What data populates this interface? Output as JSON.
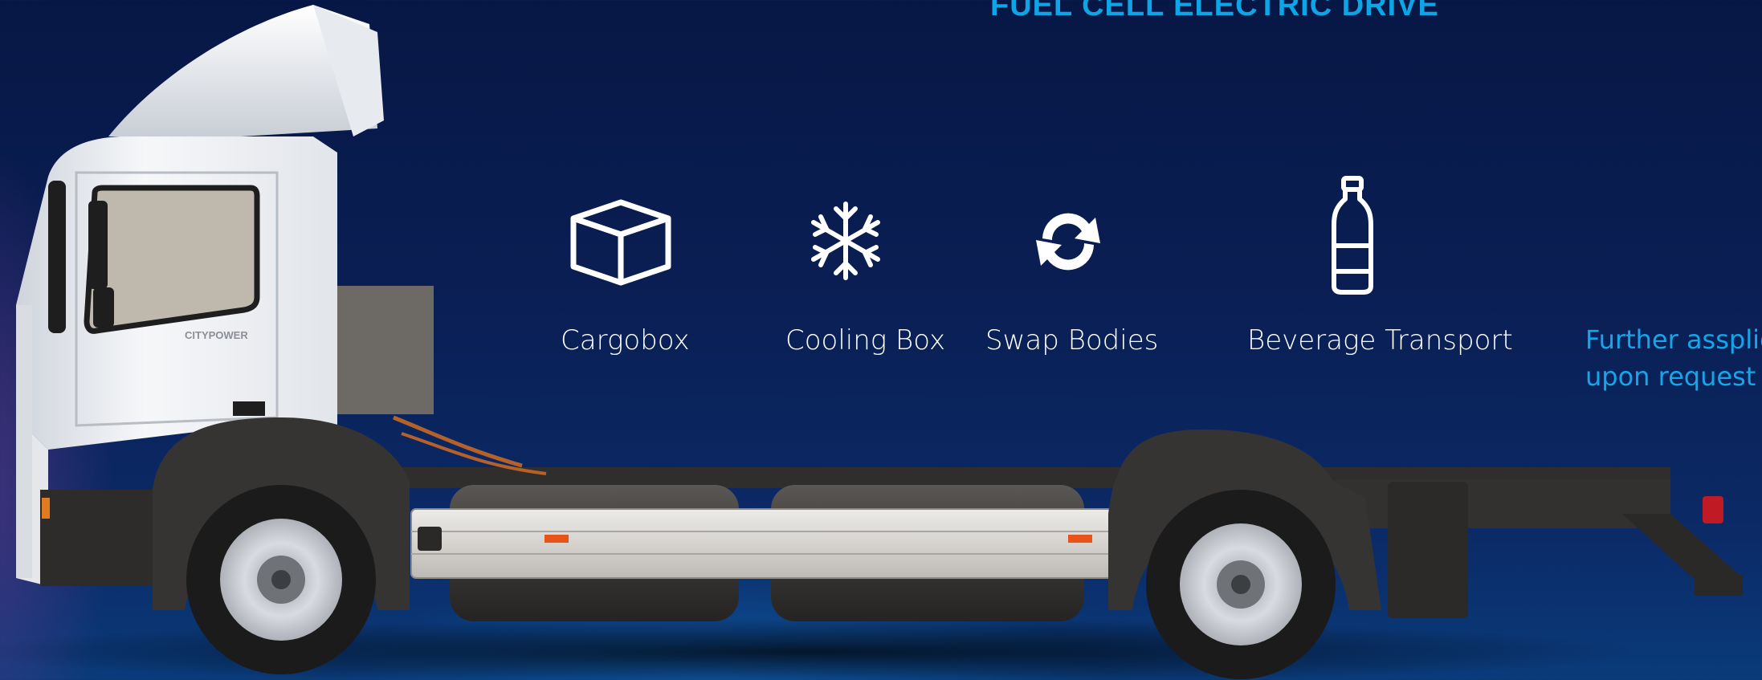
{
  "headline": "FUEL CELL ELECTRIC DRIVE",
  "applications": [
    {
      "label": "Cargobox",
      "icon": "box-icon"
    },
    {
      "label": "Cooling Box",
      "icon": "snowflake-icon"
    },
    {
      "label": "Swap Bodies",
      "icon": "swap-arrows-icon"
    },
    {
      "label": "Beverage Transport",
      "icon": "bottle-icon"
    }
  ],
  "further": {
    "line1": "Further assplic",
    "line2": "upon request"
  },
  "truck": {
    "cab_badge": "CITYPOWER"
  },
  "colors": {
    "accent": "#0ea5e6",
    "background": "#0a1f55"
  }
}
